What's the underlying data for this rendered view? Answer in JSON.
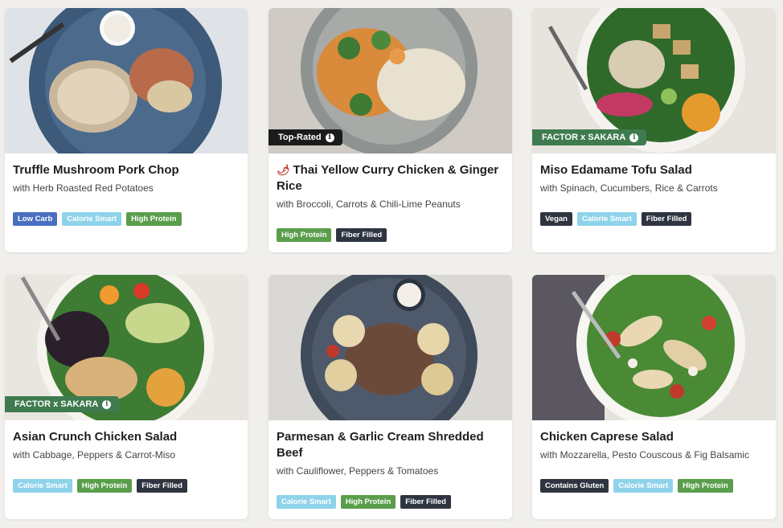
{
  "meals": [
    {
      "title": "Truffle Mushroom Pork Chop",
      "subtitle": "with Herb Roasted Red Potatoes",
      "ribbon": "",
      "tags": [
        "Low Carb",
        "Calorie Smart",
        "High Protein"
      ]
    },
    {
      "title": "Thai Yellow Curry Chicken & Ginger Rice",
      "subtitle": "with Broccoli, Carrots & Chili-Lime Peanuts",
      "ribbon": "Top-Rated",
      "spicy_icon": "chili-pepper-icon",
      "tags": [
        "High Protein",
        "Fiber Filled"
      ]
    },
    {
      "title": "Miso Edamame Tofu Salad",
      "subtitle": "with Spinach, Cucumbers, Rice & Carrots",
      "ribbon": "FACTOR x SAKARA",
      "tags": [
        "Vegan",
        "Calorie Smart",
        "Fiber Filled"
      ]
    },
    {
      "title": "Asian Crunch Chicken Salad",
      "subtitle": "with Cabbage, Peppers & Carrot-Miso",
      "ribbon": "FACTOR x SAKARA",
      "tags": [
        "Calorie Smart",
        "High Protein",
        "Fiber Filled"
      ]
    },
    {
      "title": "Parmesan & Garlic Cream Shredded Beef",
      "subtitle": "with Cauliflower, Peppers & Tomatoes",
      "ribbon": "",
      "tags": [
        "Calorie Smart",
        "High Protein",
        "Fiber Filled"
      ]
    },
    {
      "title": "Chicken Caprese Salad",
      "subtitle": "with Mozzarella, Pesto Couscous & Fig Balsamic",
      "ribbon": "",
      "tags": [
        "Contains Gluten",
        "Calorie Smart",
        "High Protein"
      ]
    }
  ],
  "info_icon_glyph": "i",
  "colors": {
    "low_carb": "#4a6fc1",
    "calorie_smart": "#8fd3ea",
    "high_protein": "#5a9e4b",
    "dark_tag": "#2f3540",
    "top_rated_ribbon": "#1b1b1b",
    "sakara_ribbon": "#3f7b4f"
  }
}
